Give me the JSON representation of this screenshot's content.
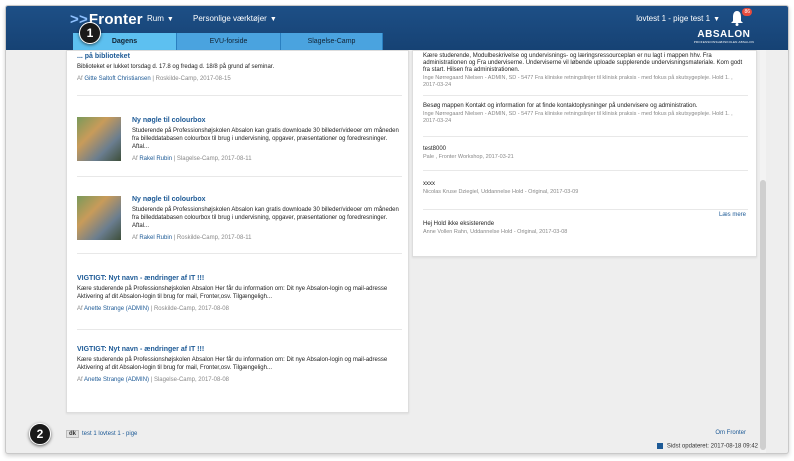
{
  "app": {
    "logo": "Fronter",
    "menus": [
      "Rum",
      "Personlige værktøjer"
    ],
    "user": "lovtest 1 - pige test 1",
    "notifications_count": "86",
    "brand": "ABSALON",
    "brand_sub": "PROFESSIONSHØJSKOLEN ABSALON"
  },
  "tabs": [
    "Dagens",
    "EVU-forside",
    "Slagelse-Camp"
  ],
  "news": [
    {
      "title": "... på biblioteket",
      "body": "Biblioteket er lukket torsdag d. 17.8 og fredag d. 18/8 på grund af seminar.",
      "author_prefix": "Af",
      "author": "Gitte Saltoft Christiansen",
      "meta": "| Roskilde-Camp, 2017-08-15"
    },
    {
      "title": "Ny nøgle til colourbox",
      "body": "Studerende på Professionshøjskolen Absalon kan gratis downloade 30 billeder/videoer om måneden fra billeddatabasen colourbox til brug i undervisning, opgaver, præsentationer og foredresninger. Aftal...",
      "author_prefix": "Af",
      "author": "Rakel Rubin",
      "meta": "| Slagelse-Camp, 2017-08-11"
    },
    {
      "title": "Ny nøgle til colourbox",
      "body": "Studerende på Professionshøjskolen Absalon kan gratis downloade 30 billeder/videoer om måneden fra billeddatabasen colourbox til brug i undervisning, opgaver, præsentationer og foredresninger. Aftal...",
      "author_prefix": "Af",
      "author": "Rakel Rubin",
      "meta": "| Roskilde-Camp, 2017-08-11"
    },
    {
      "title": "VIGTIGT: Nyt navn - ændringer af IT !!!",
      "body": "Kære studerende på Professionshøjskolen Absalon Her får du information om: Dit nye Absalon-login og mail-adresse Aktivering af dit Absalon-login til brug for mail, Fronter,osv. Tilgængeligh...",
      "author_prefix": "Af",
      "author": "Anette Strange (ADMIN)",
      "meta": "| Roskilde-Camp, 2017-08-08"
    },
    {
      "title": "VIGTIGT: Nyt navn - ændringer af IT !!!",
      "body": "Kære studerende på Professionshøjskolen Absalon Her får du information om: Dit nye Absalon-login og mail-adresse Aktivering af dit Absalon-login til brug for mail, Fronter,osv. Tilgængeligh...",
      "author_prefix": "Af",
      "author": "Anette Strange (ADMIN)",
      "meta": "| Slagelse-Camp, 2017-08-08"
    }
  ],
  "messages": [
    {
      "body": "Kære studerende, Modulbeskrivelse og undervisnings- og læringsressourceplan er nu lagt i mappen hhv. Fra administrationen og Fra underviserne. Underviserne vil løbende uploade supplerende undervisningsmateriale. Kom godt fra start. Hilsen fra administrationen.",
      "meta": "Inge Nørregaard Nielsen - ADMIN, SD - 5477 Fra kliniske retningslinjer til klinisk praksis - med fokus på skutsygepleje. Hold 1. , 2017-03-24"
    },
    {
      "body": "Besøg mappen Kontakt og information for at finde kontaktoplysninger på undervisere og administration.",
      "meta": "Inge Nørregaard Nielsen - ADMIN, SD - 5477 Fra kliniske retningslinjer til klinisk praksis - med fokus på skutsygepleje. Hold 1. , 2017-03-24"
    },
    {
      "body": "test8000",
      "meta": "Pale , Fronter Workshop, 2017-03-21"
    },
    {
      "body": "xxxx",
      "meta": "Nicolas Kruse Dziegiel, Uddannelse Hold - Original, 2017-03-09"
    },
    {
      "body": "Hej Hold ikke eksisterende",
      "meta": "Anne Vollen Rahn, Uddannelse Hold - Original, 2017-03-08"
    }
  ],
  "read_more": "Læs mere",
  "footer": {
    "lang": "dk",
    "user": "test 1 lovtest 1 - pige",
    "about": "Om Fronter",
    "updated": "Sidst opdateret: 2017-08-18 09:42"
  },
  "callouts": [
    "1",
    "2"
  ]
}
